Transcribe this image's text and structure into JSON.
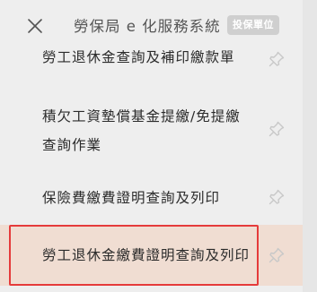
{
  "header": {
    "close_icon": "close-icon",
    "title": "勞保局 e 化服務系統",
    "role_badge": "投保單位"
  },
  "menu": {
    "items": [
      {
        "label": "勞工退休金查詢及補印繳款單",
        "icon": "pin-icon"
      },
      {
        "label": "積欠工資墊償基金提繳/免提繳查詢作業",
        "icon": "pin-icon"
      },
      {
        "label": "保險費繳費證明查詢及列印",
        "icon": "pin-icon"
      },
      {
        "label": "勞工退休金繳費證明查詢及列印",
        "icon": "pin-icon",
        "selected": true
      }
    ]
  },
  "colors": {
    "background": "#eeeeee",
    "selected_item_bg": "#f0ddd2",
    "highlight_border": "#e53b3b",
    "badge_bg": "#cfcfcf"
  }
}
